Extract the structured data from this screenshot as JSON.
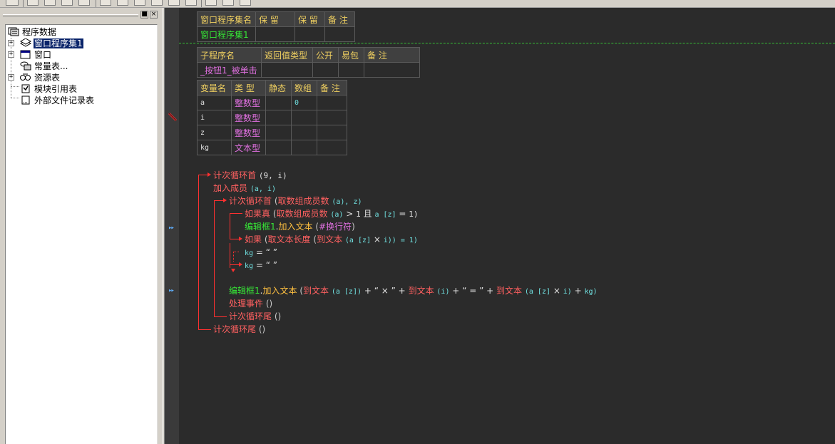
{
  "tree": {
    "root": "程序数据",
    "items": [
      {
        "label": "窗口程序集1",
        "icon": "module-icon",
        "selected": true
      },
      {
        "label": "窗口",
        "icon": "window-icon"
      },
      {
        "label": "常量表...",
        "icon": "constant-icon"
      },
      {
        "label": "资源表",
        "icon": "resource-icon"
      },
      {
        "label": "模块引用表",
        "icon": "module-ref-icon"
      },
      {
        "label": "外部文件记录表",
        "icon": "file-record-icon"
      }
    ]
  },
  "assembly_table": {
    "headers": [
      "窗口程序集名",
      "保 留",
      "保 留",
      "备 注"
    ],
    "row": [
      "窗口程序集1",
      "",
      "",
      ""
    ]
  },
  "sub_table": {
    "headers": [
      "子程序名",
      "返回值类型",
      "公开",
      "易包",
      "备 注"
    ],
    "row": [
      "_按钮1_被单击",
      "",
      "",
      "",
      ""
    ]
  },
  "var_table": {
    "headers": [
      "变量名",
      "类 型",
      "静态",
      "数组",
      "备 注"
    ],
    "rows": [
      [
        "a",
        "整数型",
        "",
        "0",
        ""
      ],
      [
        "i",
        "整数型",
        "",
        "",
        ""
      ],
      [
        "z",
        "整数型",
        "",
        "",
        ""
      ],
      [
        "kg",
        "文本型",
        "",
        "",
        ""
      ]
    ]
  },
  "code": {
    "l1": {
      "cmd": "计次循环首",
      "args": "(9, i)"
    },
    "l2": {
      "cmd": "加入成员",
      "args": "(a, i)"
    },
    "l3": {
      "cmd": "计次循环首",
      "p1": "(",
      "fn": "取数组成员数",
      "p2": "(a), z)"
    },
    "l4": {
      "cmd": "如果真",
      "p1": "(",
      "fn": "取数组成员数",
      "p2": "(a)",
      "op1": ">",
      "n1": "1",
      "and": "且",
      "arr": "a [z]",
      "op2": "=",
      "n2": "1)"
    },
    "l5": {
      "obj": "编辑框1",
      "dot": ".",
      "method": "加入文本",
      "p1": "(",
      "arg": "#换行符",
      "p2": ")"
    },
    "l6": {
      "cmd": "如果",
      "p1": "(",
      "fn": "取文本长度",
      "p2": "(",
      "fn2": "到文本",
      "p3": "(a [z]",
      "op": "×",
      "v": "i)) = 1)"
    },
    "l7": {
      "var": "kg",
      "eq": "=",
      "str": "“  ”"
    },
    "l8": {
      "var": "kg",
      "eq": "=",
      "str": "“ ”"
    },
    "l9": {
      "obj": "编辑框1",
      "dot": ".",
      "method": "加入文本",
      "p1": "(",
      "fn1": "到文本",
      "a1": "(a [z])",
      "plus1": "+",
      "s1": "“ × ”",
      "plus2": "+",
      "fn2": "到文本",
      "a2": "(i)",
      "plus3": "+",
      "s2": "“ = ”",
      "plus4": "+",
      "fn3": "到文本",
      "a3": "(a [z]",
      "op": "×",
      "a4": "i)",
      "plus5": "+",
      "a5": "kg)"
    },
    "l10": {
      "cmd": "处理事件",
      "args": "()"
    },
    "l11": {
      "cmd": "计次循环尾",
      "args": "()"
    },
    "l12": {
      "cmd": "计次循环尾",
      "args": "()"
    }
  },
  "gutter_marks": [
    "▸▸",
    "▸▸"
  ]
}
